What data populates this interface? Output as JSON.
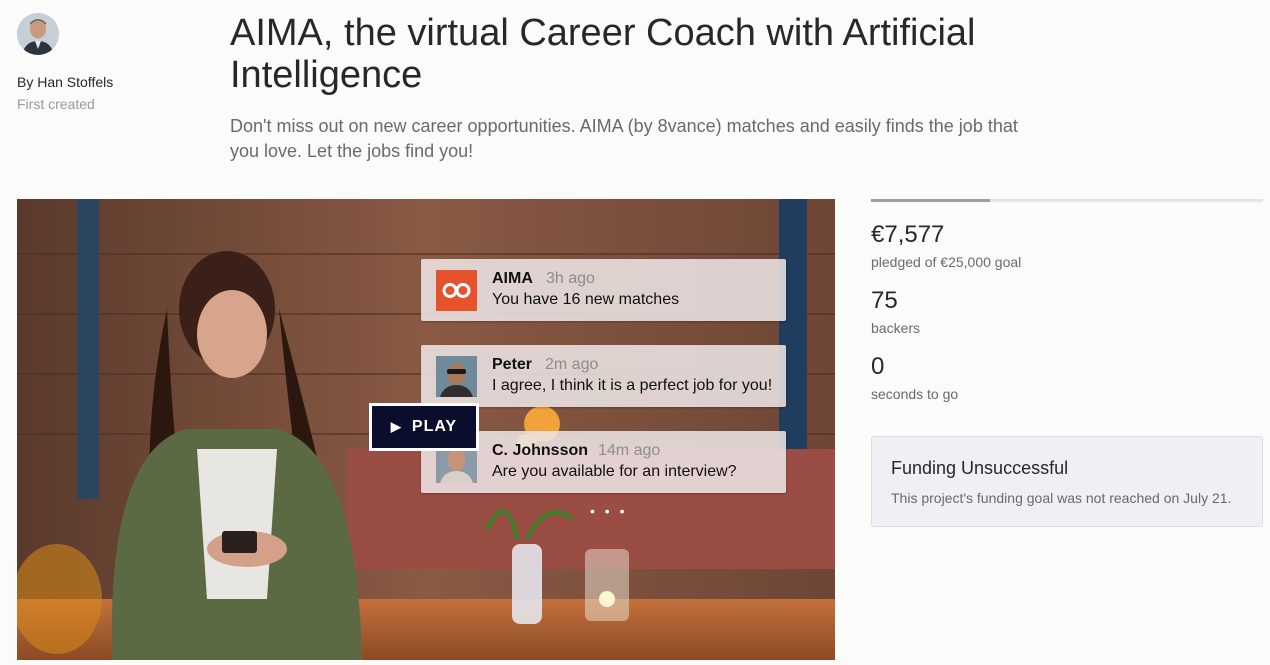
{
  "creator": {
    "by_label": "By Han Stoffels",
    "first_created_label": "First created"
  },
  "project": {
    "title": "AIMA, the virtual Career Coach with Artificial Intelligence",
    "blurb": "Don't miss out on new career opportunities. AIMA (by 8vance) matches and easily finds the job that you love. Let the jobs find you!"
  },
  "video": {
    "play_label": "PLAY",
    "notifications": [
      {
        "name": "AIMA",
        "time": "3h ago",
        "text": "You have 16 new matches"
      },
      {
        "name": "Peter",
        "time": "2m ago",
        "text": "I agree, I think it is a perfect job for you!"
      },
      {
        "name": "C. Johnsson",
        "time": "14m ago",
        "text": "Are you available for an interview?"
      }
    ],
    "more_indicator": "• • •"
  },
  "stats": {
    "funded_fraction": 0.303,
    "pledged_amount": "€7,577",
    "pledged_label": "pledged of €25,000 goal",
    "backers_count": "75",
    "backers_label": "backers",
    "time_left": "0",
    "time_left_label": "seconds to go"
  },
  "status": {
    "heading": "Funding Unsuccessful",
    "text": "This project's funding goal was not reached on July 21."
  },
  "colors": {
    "play_button": "#0b0d2c",
    "aima_brand": "#e6522c",
    "progress_fill": "#9e9ea6"
  }
}
